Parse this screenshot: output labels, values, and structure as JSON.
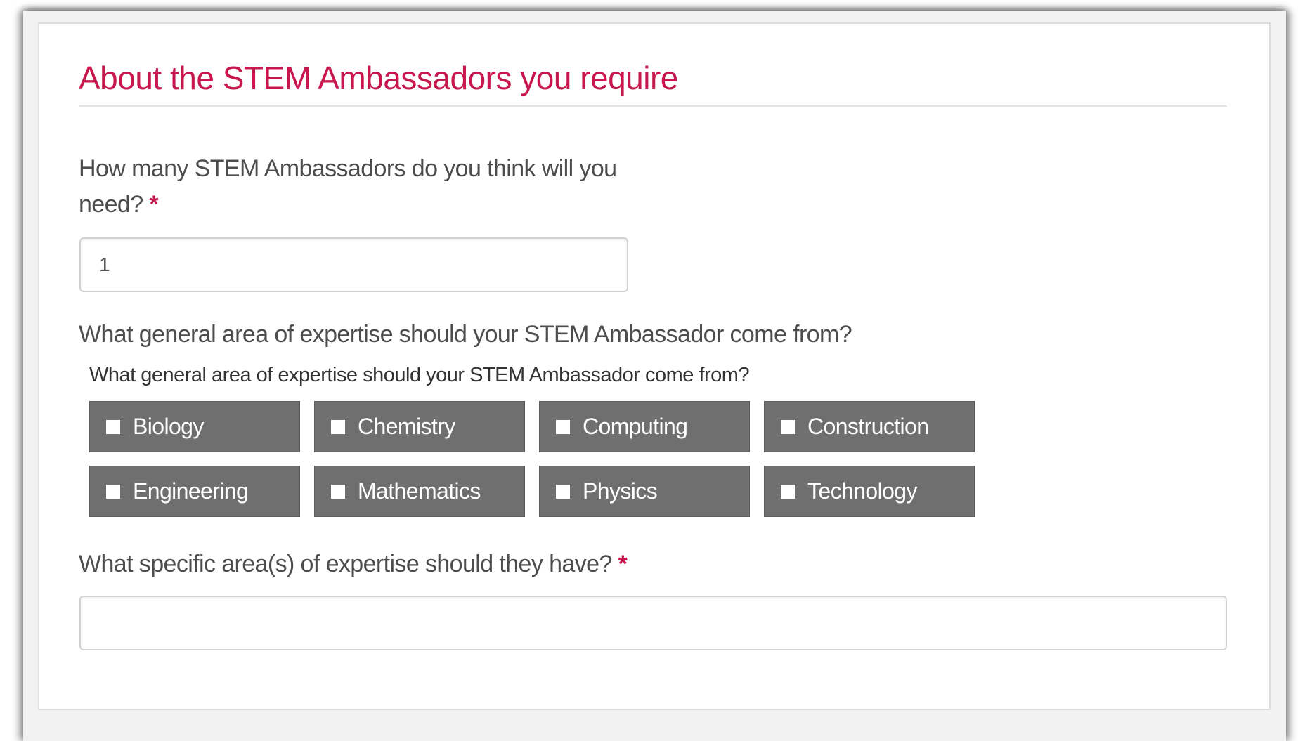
{
  "section": {
    "title": "About the STEM Ambassadors you require"
  },
  "questions": {
    "ambassador_count": {
      "label_line1": "How many STEM Ambassadors do you think will you",
      "label_line2": "need?",
      "required_marker": "*",
      "value": "1"
    },
    "general_area": {
      "label": "What general area of expertise should your STEM Ambassador come from?",
      "group_legend": "What general area of expertise should your STEM Ambassador come from?",
      "options": [
        {
          "label": "Biology",
          "checked": false
        },
        {
          "label": "Chemistry",
          "checked": false
        },
        {
          "label": "Computing",
          "checked": false
        },
        {
          "label": "Construction",
          "checked": false
        },
        {
          "label": "Engineering",
          "checked": false
        },
        {
          "label": "Mathematics",
          "checked": false
        },
        {
          "label": "Physics",
          "checked": false
        },
        {
          "label": "Technology",
          "checked": false
        }
      ]
    },
    "specific_area": {
      "label": "What specific area(s) of expertise should they have?",
      "required_marker": "*",
      "value": ""
    }
  },
  "colors": {
    "accent": "#c8174f",
    "option_tile_background": "#6f6f6f",
    "label_text": "#4d4d4d"
  }
}
